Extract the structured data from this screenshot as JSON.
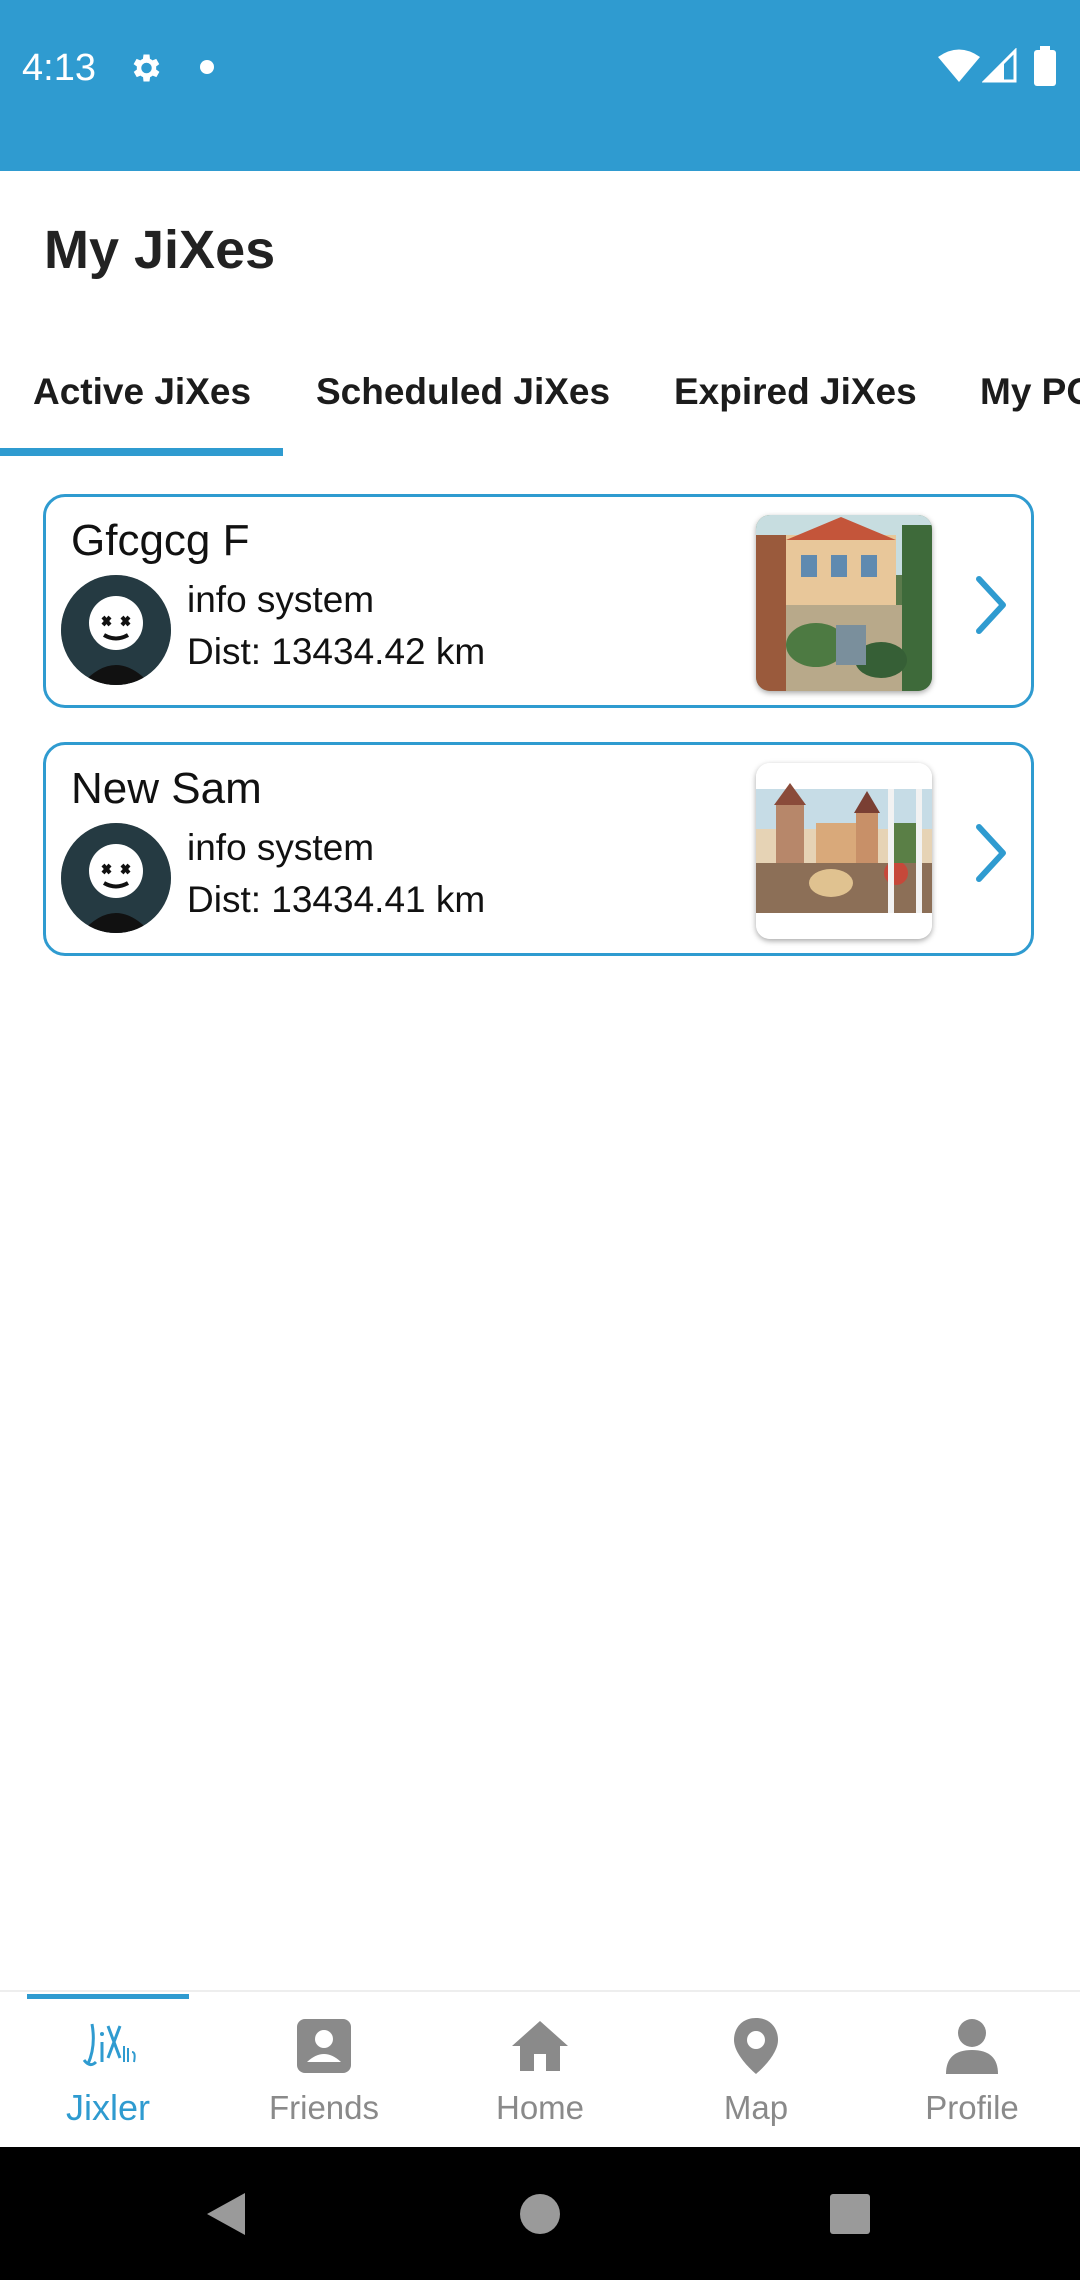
{
  "status_bar": {
    "time": "4:13",
    "icons": [
      "gear-icon",
      "dot-icon",
      "wifi-icon",
      "signal-icon",
      "battery-icon"
    ],
    "background": "#2f9bd0"
  },
  "header": {
    "title": "My JiXes"
  },
  "tabs": [
    {
      "label": "Active JiXes",
      "selected": true
    },
    {
      "label": "Scheduled JiXes",
      "selected": false
    },
    {
      "label": "Expired JiXes",
      "selected": false
    },
    {
      "label": "My PO",
      "selected": false
    }
  ],
  "cards": [
    {
      "name": "Gfcgcg F",
      "line1": "info system",
      "line2": "Dist: 13434.42 km",
      "avatar_icon": "avatar-icon",
      "thumbnail": "courtyard-thumbnail",
      "chevron_icon": "chevron-right-icon"
    },
    {
      "name": "New Sam",
      "line1": "info system",
      "line2": "Dist: 13434.41 km",
      "avatar_icon": "avatar-icon",
      "thumbnail": "castle-window-thumbnail",
      "chevron_icon": "chevron-right-icon"
    }
  ],
  "bottom_nav": [
    {
      "label": "Jixler",
      "icon": "jixler-logo-icon",
      "active": true
    },
    {
      "label": "Friends",
      "icon": "friends-icon",
      "active": false
    },
    {
      "label": "Home",
      "icon": "home-icon",
      "active": false
    },
    {
      "label": "Map",
      "icon": "map-pin-icon",
      "active": false
    },
    {
      "label": "Profile",
      "icon": "profile-icon",
      "active": false
    }
  ],
  "system_nav": {
    "buttons": [
      "back-icon",
      "home-circle-icon",
      "recents-icon"
    ]
  },
  "colors": {
    "accent": "#2f9bd0",
    "inactive_nav": "#8a8a8a",
    "text": "#111111"
  },
  "logo": {
    "lettering": "JiXler"
  }
}
